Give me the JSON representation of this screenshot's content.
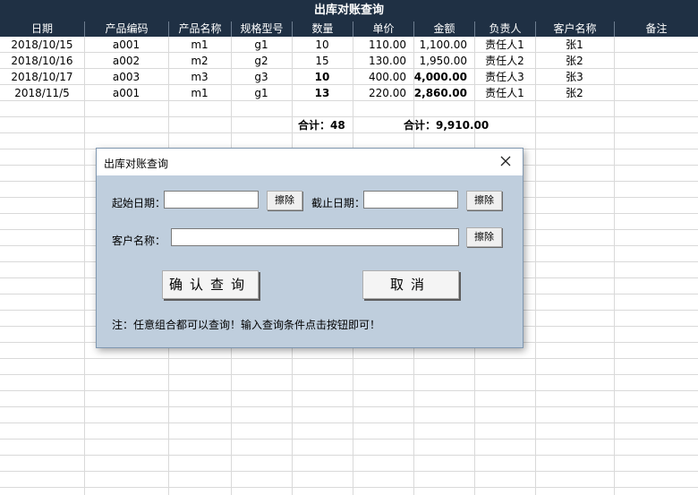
{
  "sheet": {
    "title": "出库对账查询",
    "headers": [
      "日期",
      "产品编码",
      "产品名称",
      "规格型号",
      "数量",
      "单价",
      "金额",
      "负责人",
      "客户名称",
      "备注"
    ],
    "rows": [
      {
        "date": "2018/10/15",
        "code": "a001",
        "name": "m1",
        "spec": "g1",
        "qty": "10",
        "price": "110.00",
        "amount": "1,100.00",
        "owner": "责任人1",
        "customer": "张1",
        "note": ""
      },
      {
        "date": "2018/10/16",
        "code": "a002",
        "name": "m2",
        "spec": "g2",
        "qty": "15",
        "price": "130.00",
        "amount": "1,950.00",
        "owner": "责任人2",
        "customer": "张2",
        "note": ""
      },
      {
        "date": "2018/10/17",
        "code": "a003",
        "name": "m3",
        "spec": "g3",
        "qty": "10",
        "price": "400.00",
        "amount": "4,000.00",
        "owner": "责任人3",
        "customer": "张3",
        "note": ""
      },
      {
        "date": "2018/11/5",
        "code": "a001",
        "name": "m1",
        "spec": "g1",
        "qty": "13",
        "price": "220.00",
        "amount": "2,860.00",
        "owner": "责任人1",
        "customer": "张2",
        "note": ""
      }
    ],
    "qty_total": "合计：48",
    "amount_total": "合计：9,910.00"
  },
  "dialog": {
    "title": "出库对账查询",
    "start_label": "起始日期：",
    "end_label": "截止日期：",
    "customer_label": "客户名称：",
    "start_value": "",
    "end_value": "",
    "customer_value": "",
    "clear_label": "擦除",
    "confirm_label": "确认查询",
    "cancel_label": "取消",
    "note": "注：任意组合都可以查询！输入查询条件点击按钮即可！"
  },
  "colors": {
    "header_bg": "#1f3044",
    "dialog_bg": "#bfcedd"
  }
}
